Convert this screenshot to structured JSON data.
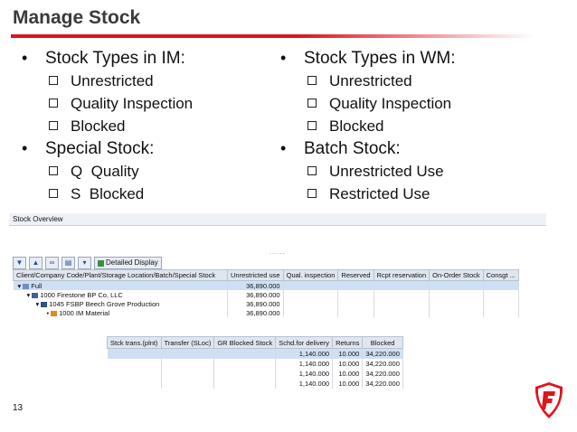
{
  "title": "Manage Stock",
  "left_column": [
    {
      "label": "Stock Types in IM:",
      "items": [
        "Unrestricted",
        "Quality Inspection",
        "Blocked"
      ]
    },
    {
      "label": "Special Stock:",
      "items": [
        "Q  Quality",
        "S  Blocked"
      ]
    }
  ],
  "right_column": [
    {
      "label": "Stock Types in WM:",
      "items": [
        "Unrestricted",
        "Quality Inspection",
        "Blocked"
      ]
    },
    {
      "label": "Batch Stock:",
      "items": [
        "Unrestricted Use",
        "Restricted Use"
      ]
    }
  ],
  "sap": {
    "window_title": "Stock Overview",
    "detailed_display": "Detailed Display",
    "columns": [
      "Client/Company Code/Plant/Storage Location/Batch/Special Stock",
      "Unrestricted use",
      "Qual. inspection",
      "Reserved",
      "Rcpt reservation",
      "On-Order Stock",
      "Consgt ..."
    ],
    "rows": [
      {
        "node": "Full",
        "value": "36,890.000"
      },
      {
        "node": "1000 Firestone BP Co, LLC",
        "value": "36,890.000"
      },
      {
        "node": "1045 FSBP Beech Grove Production",
        "value": "36,890.000"
      },
      {
        "node": "1000 IM Material",
        "value": "36,890.000"
      }
    ]
  },
  "sap2": {
    "columns": [
      "Stck trans.(plnt)",
      "Transfer (SLoc)",
      "GR Blocked Stock",
      "Schd.for delivery",
      "Returns",
      "Blocked"
    ],
    "rows": [
      {
        "schd": "1,140.000",
        "returns": "10.000",
        "blocked": "34,220.000"
      },
      {
        "schd": "1,140.000",
        "returns": "10.000",
        "blocked": "34,220.000"
      },
      {
        "schd": "1,140.000",
        "returns": "10.000",
        "blocked": "34,220.000"
      },
      {
        "schd": "1,140.000",
        "returns": "10.000",
        "blocked": "34,220.000"
      }
    ]
  },
  "page_number": "13",
  "colors": {
    "accent": "#e0141e",
    "header_bg": "#dfe6ef",
    "selected_row": "#cfe0f5"
  },
  "icons": [
    "expand-all-icon",
    "collapse-all-icon",
    "binoculars-icon",
    "print-icon",
    "dropdown-icon",
    "detail-icon",
    "tree-node-icon",
    "company-icon",
    "plant-icon",
    "storage-location-icon",
    "firestone-logo"
  ]
}
